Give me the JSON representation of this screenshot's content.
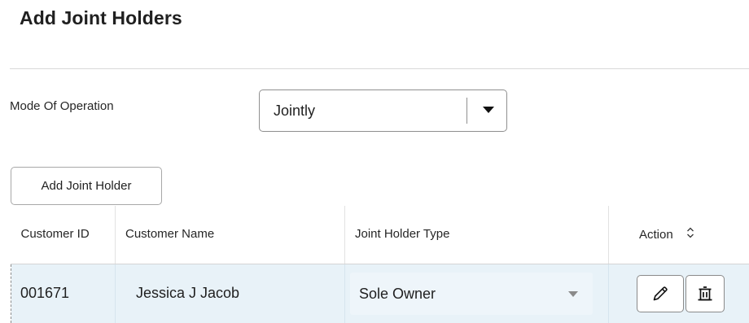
{
  "page": {
    "title": "Add Joint Holders"
  },
  "mode_of_operation": {
    "label": "Mode Of Operation",
    "selected": "Jointly",
    "caret_icon": "caret-down-icon"
  },
  "add_joint_holder_button": {
    "label": "Add Joint Holder"
  },
  "table": {
    "columns": [
      {
        "label": "Customer ID"
      },
      {
        "label": "Customer Name"
      },
      {
        "label": "Joint Holder Type"
      },
      {
        "label": "Action",
        "icon": "sort-icon"
      }
    ],
    "rows": [
      {
        "customer_id": "001671",
        "customer_name": "Jessica J Jacob",
        "joint_holder_type": "Sole Owner",
        "actions": [
          "edit-icon",
          "delete-icon"
        ]
      }
    ]
  },
  "colors": {
    "row_highlight": "#e8f2f8",
    "border": "#8f8f8f"
  }
}
